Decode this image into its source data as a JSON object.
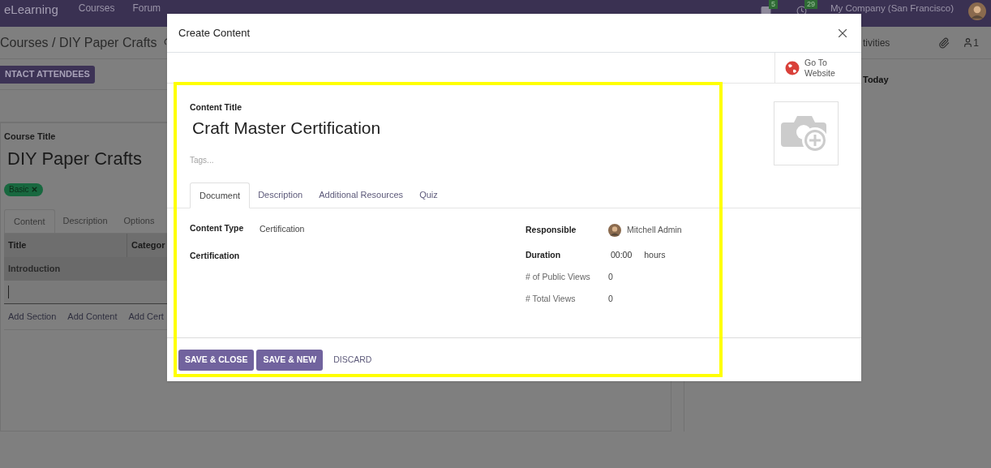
{
  "navbar": {
    "app": "eLearning",
    "menus": [
      "Courses",
      "Forum"
    ],
    "messages_badge": "5",
    "activities_badge": "29",
    "company": "My Company (San Francisco)"
  },
  "control_panel": {
    "breadcrumb": "Courses / DIY Paper Crafts",
    "action_button": "NTACT ATTENDEES",
    "activities_button": "tivities",
    "followers_count": "1"
  },
  "course_form": {
    "title_label": "Course Title",
    "title": "DIY Paper Crafts",
    "tags": [
      "Basic"
    ],
    "tabs": [
      {
        "label": "Content",
        "selected": true
      },
      {
        "label": "Description",
        "selected": false
      },
      {
        "label": "Options",
        "selected": false
      }
    ],
    "columns": [
      "Title",
      "Categor"
    ],
    "section_row": "Introduction",
    "add_links": [
      "Add Section",
      "Add Content",
      "Add Cert"
    ]
  },
  "chatter": {
    "day_header": "Today"
  },
  "dialog": {
    "title": "Create Content",
    "smart_button": "Go To Website",
    "title_label": "Content Title",
    "content_title": "Craft Master Certification",
    "tags_placeholder": "Tags...",
    "tabs": [
      {
        "label": "Document",
        "selected": true
      },
      {
        "label": "Description",
        "selected": false
      },
      {
        "label": "Additional Resources",
        "selected": false
      },
      {
        "label": "Quiz",
        "selected": false
      }
    ],
    "left_fields": [
      {
        "label": "Content Type",
        "value": "Certification"
      },
      {
        "label": "Certification"
      }
    ],
    "responsible": {
      "label": "Responsible",
      "value": "Mitchell Admin"
    },
    "duration": {
      "label": "Duration",
      "value": "00:00",
      "unit": "hours"
    },
    "stats": [
      {
        "label": "# of Public Views",
        "value": "0"
      },
      {
        "label": "# Total Views",
        "value": "0"
      }
    ],
    "buttons": [
      {
        "label": "SAVE & CLOSE",
        "kind": "primary"
      },
      {
        "label": "SAVE & NEW",
        "kind": "primary"
      },
      {
        "label": "DISCARD",
        "kind": "link"
      }
    ]
  }
}
